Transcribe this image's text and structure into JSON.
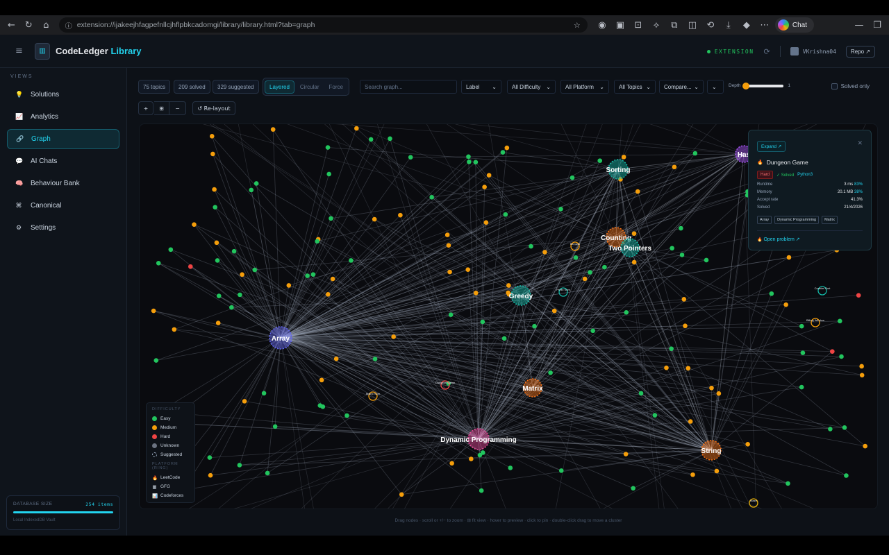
{
  "browser": {
    "url": "extension://ijakeejhfagpefnllcjhflpbkcadomgi/library/library.html?tab=graph",
    "chat_label": "Chat"
  },
  "header": {
    "brand_main": "CodeLedger",
    "brand_accent": "Library",
    "extension_label": "EXTENSION",
    "username": "VKrishna04",
    "repo_label": "Repo ↗"
  },
  "sidebar": {
    "views_heading": "VIEWS",
    "items": [
      {
        "label": "Solutions",
        "icon": "💡"
      },
      {
        "label": "Analytics",
        "icon": "📈"
      },
      {
        "label": "Graph",
        "icon": "🔗"
      },
      {
        "label": "AI Chats",
        "icon": "💬"
      },
      {
        "label": "Behaviour Bank",
        "icon": "🧠"
      },
      {
        "label": "Canonical",
        "icon": "⌘"
      },
      {
        "label": "Settings",
        "icon": "⚙"
      }
    ],
    "db": {
      "title": "DATABASE SIZE",
      "count": "254 items",
      "subtitle": "Local IndexedDB Vault"
    }
  },
  "toolbar": {
    "topics_chip": "75 topics",
    "solved_chip": "209 solved",
    "suggested_chip": "329 suggested",
    "layouts": [
      "Layered",
      "Circular",
      "Force"
    ],
    "search_placeholder": "Search graph...",
    "label_select": "Label",
    "difficulty_select": "All Difficulty",
    "platform_select": "All Platform",
    "topics_select": "All Topics",
    "compare_select": "Compare...",
    "depth_label": "Depth",
    "depth_value": "1",
    "solved_only": "Solved only",
    "zoom_in": "+",
    "fit": "⊞",
    "zoom_out": "−",
    "relayout": "↺ Re-layout"
  },
  "legend": {
    "difficulty_heading": "DIFFICULTY",
    "difficulty": [
      {
        "label": "Easy",
        "color": "#22c55e"
      },
      {
        "label": "Medium",
        "color": "#f59e0b"
      },
      {
        "label": "Hard",
        "color": "#ef4444"
      },
      {
        "label": "Unknown",
        "color": "#6b7280"
      },
      {
        "label": "Suggested",
        "color": ""
      }
    ],
    "platform_heading": "PLATFORM (RING)",
    "platforms": [
      {
        "label": "LeetCode",
        "icon": "🔥"
      },
      {
        "label": "GFG",
        "icon": "▦"
      },
      {
        "label": "Codeforces",
        "icon": "📊"
      }
    ]
  },
  "hubs": [
    {
      "label": "Array",
      "color": "#6366f1"
    },
    {
      "label": "Dynamic Programming",
      "color": "#ec4899"
    },
    {
      "label": "String",
      "color": "#f97316"
    },
    {
      "label": "Matrix",
      "color": "#f97316"
    },
    {
      "label": "Greedy",
      "color": "#14b8a6"
    },
    {
      "label": "Sorting",
      "color": "#14b8a6"
    },
    {
      "label": "Counting",
      "color": "#f97316"
    },
    {
      "label": "Two Pointers",
      "color": "#14b8a6"
    },
    {
      "label": "Has",
      "color": "#a855f7"
    }
  ],
  "small_labels": [
    "Dungeon Game",
    "Matrix Sum",
    "Bitmask",
    "Prefix Sum",
    "Counter Sort",
    "Billing Window",
    "Maze"
  ],
  "popover": {
    "expand_label": "Expand ↗",
    "title": "Dungeon Game",
    "difficulty": "Hard",
    "status": "✓ Solved",
    "language": "Python3",
    "rows": [
      {
        "k": "Runtime",
        "v": "3 ms",
        "p": "83%"
      },
      {
        "k": "Memory",
        "v": "20.1 MB",
        "p": "38%"
      },
      {
        "k": "Accept rate",
        "v": "41.3%",
        "p": ""
      },
      {
        "k": "Solved",
        "v": "21/4/2026",
        "p": ""
      }
    ],
    "topics": [
      "Array",
      "Dynamic Programming",
      "Matrix"
    ],
    "open_label": "Open problem ↗"
  },
  "footer_hint": "Drag nodes · scroll or +/− to zoom · ⊞ fit view · hover to preview · click to pin · double-click drag to move a cluster"
}
